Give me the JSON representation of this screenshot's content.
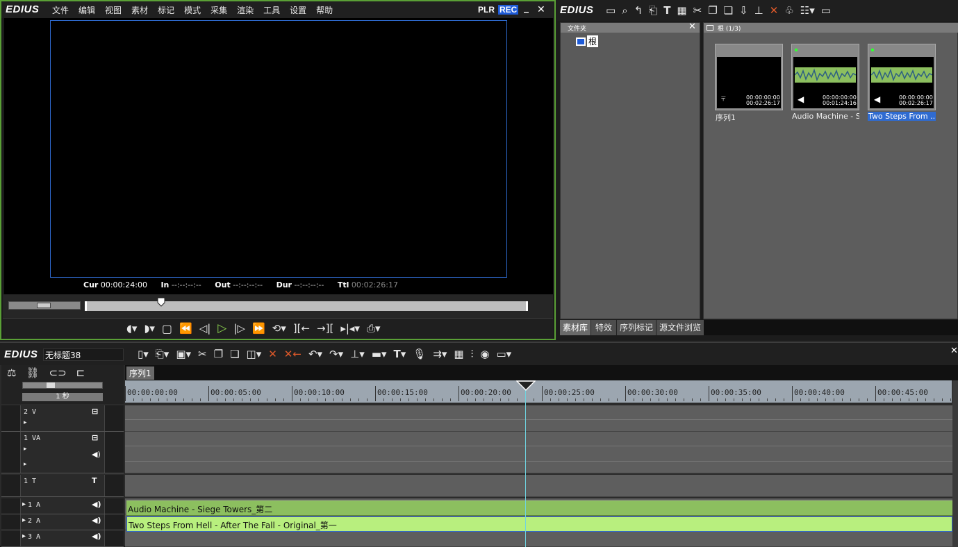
{
  "player": {
    "logo": "EDIUS",
    "menu": [
      "文件",
      "编辑",
      "视图",
      "素材",
      "标记",
      "模式",
      "采集",
      "渲染",
      "工具",
      "设置",
      "帮助"
    ],
    "plr": "PLR",
    "rec": "REC",
    "min": "_",
    "close": "✕",
    "timecodes": [
      {
        "label": "Cur",
        "value": "00:00:24:00"
      },
      {
        "label": "In",
        "value": "--:--:--:--"
      },
      {
        "label": "Out",
        "value": "--:--:--:--"
      },
      {
        "label": "Dur",
        "value": "--:--:--:--"
      },
      {
        "label": "Ttl",
        "value": "00:02:26:17"
      }
    ],
    "position_fraction": 0.17
  },
  "bin": {
    "logo": "EDIUS",
    "folder_title": "文件夹",
    "root_label": "根",
    "bin_path": "根 (1/3)",
    "clips": [
      {
        "name": "序列1",
        "tc1": "00:00:00:00",
        "tc2": "00:02:26:17",
        "selected": false,
        "kind": "sequence"
      },
      {
        "name": "Audio Machine - S...",
        "tc1": "00:00:00:00",
        "tc2": "00:01:24:16",
        "selected": false,
        "kind": "audio"
      },
      {
        "name": "Two Steps From ...",
        "tc1": "00:00:00:00",
        "tc2": "00:02:26:17",
        "selected": true,
        "kind": "audio"
      }
    ],
    "tabs": [
      "素材库",
      "特效",
      "序列标记",
      "源文件浏览"
    ]
  },
  "timeline": {
    "logo": "EDIUS",
    "project_name": "无标题38",
    "sequence_tab": "序列1",
    "scale_label": "1 秒",
    "ruler": [
      "00:00:00:00",
      "00:00:05:00",
      "00:00:10:00",
      "00:00:15:00",
      "00:00:20:00",
      "00:00:25:00",
      "00:00:30:00",
      "00:00:35:00",
      "00:00:40:00",
      "00:00:45:00"
    ],
    "tracks": [
      {
        "name": "2 V"
      },
      {
        "name": "1 VA"
      },
      {
        "name": "1 T"
      },
      {
        "name": "1 A"
      },
      {
        "name": "2 A"
      },
      {
        "name": "3 A"
      }
    ],
    "clip_a1": "Audio Machine - Siege Towers_第二",
    "clip_a2": "Two Steps From Hell - After The Fall - Original_第一"
  },
  "colors": {
    "player_border": "#5aa036",
    "rec_blue": "#1e5bd8",
    "selection_blue": "#2f6bd1",
    "audio_clip": "#8cbf5f",
    "audio_clip_selected": "#b8ef7e",
    "cursor_line": "#6fd4e0"
  }
}
